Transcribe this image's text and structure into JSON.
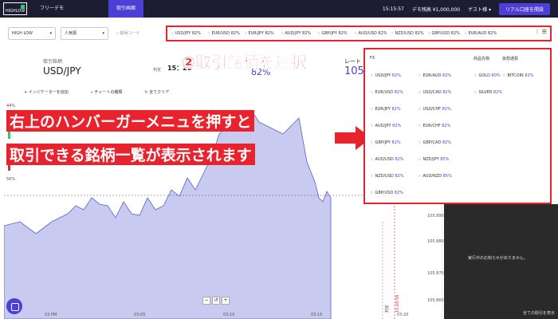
{
  "topbar": {
    "logo": "HIGHLOW",
    "tab_free": "フリーデモ",
    "tab_trade": "取引画面",
    "time": "15:15:57",
    "balance": "デモ残高 ¥1,000,000",
    "user": "ゲスト様",
    "real_button": "リアル口座を開設"
  },
  "filters": {
    "select1": "HIGH LOW",
    "select2": "人気順",
    "search_placeholder": "銘柄コード"
  },
  "favorites": [
    {
      "name": "USD/JPY",
      "pct": "82%"
    },
    {
      "name": "EUR/USD",
      "pct": "82%"
    },
    {
      "name": "EUR/JPY",
      "pct": "82%"
    },
    {
      "name": "AUD/JPY",
      "pct": "82%"
    },
    {
      "name": "GBP/JPY",
      "pct": "82%"
    },
    {
      "name": "AUD/USD",
      "pct": "82%"
    },
    {
      "name": "NZD/USD",
      "pct": "82%"
    },
    {
      "name": "GBP/USD",
      "pct": "82%"
    },
    {
      "name": "EUR/AUD",
      "pct": "82%"
    }
  ],
  "trade": {
    "symbol_label": "取引銘柄",
    "symbol": "USD/JPY",
    "judge_label": "判定",
    "judge_time": "15：20",
    "pct": "82%",
    "rate_label": "レート",
    "rate": "105"
  },
  "toolbar": {
    "indicator": "インジケーターを追加",
    "chart_type": "チャートの種類",
    "clear": "全てクリア"
  },
  "annotations": {
    "step2": "②取引銘柄を選択",
    "line1": "右上のハンバーガーメニュを押すと",
    "line2": "取引できる銘柄一覧が表示されます"
  },
  "dropdown": {
    "fx_head": "FX",
    "commodity_head": "商品先物",
    "crypto_head": "仮想通貨",
    "fx_col1": [
      {
        "name": "USD/JPY",
        "pct": "82%"
      },
      {
        "name": "EUR/USD",
        "pct": "82%"
      },
      {
        "name": "EUR/JPY",
        "pct": "82%"
      },
      {
        "name": "AUD/JPY",
        "pct": "82%"
      },
      {
        "name": "GBP/JPY",
        "pct": "82%"
      },
      {
        "name": "AUD/USD",
        "pct": "82%"
      },
      {
        "name": "NZD/USD",
        "pct": "82%"
      },
      {
        "name": "GBP/USD",
        "pct": "82%"
      }
    ],
    "fx_col2": [
      {
        "name": "EUR/AUD",
        "pct": "82%"
      },
      {
        "name": "USD/CAD",
        "pct": "82%"
      },
      {
        "name": "USD/CHF",
        "pct": "82%"
      },
      {
        "name": "EUR/CHF",
        "pct": "82%"
      },
      {
        "name": "GBP/CAD",
        "pct": "82%"
      },
      {
        "name": "NZD/JPY",
        "pct": "85%"
      },
      {
        "name": "AUD/NZD",
        "pct": "85%"
      }
    ],
    "commodity": [
      {
        "name": "GOLD",
        "pct": "80%"
      },
      {
        "name": "SILVER",
        "pct": "82%"
      }
    ],
    "crypto": [
      {
        "name": "BITCOIN",
        "pct": "82%"
      }
    ]
  },
  "side": {
    "empty_msg": "実行中のお知らせがありません。",
    "all_link": "全ての取引を表示"
  },
  "chart": {
    "left_ticks": [
      "44%",
      "56%"
    ],
    "right_ticks": [
      "105.890",
      "105.880",
      "105.870",
      "105.860"
    ],
    "x_ticks": [
      "03 PM",
      "03:05",
      "03:10",
      "03:15",
      "03:20"
    ],
    "vline_labels": [
      "判定",
      "15:20:55"
    ]
  },
  "colors": {
    "accent": "#4b3fd6",
    "annotation_red": "#e8232d",
    "topbar": "#1c1c33",
    "area_fill": "#c8caef"
  }
}
